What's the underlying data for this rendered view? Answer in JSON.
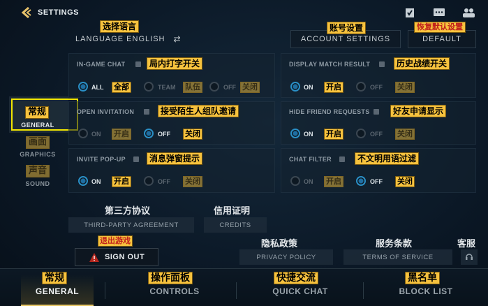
{
  "header": {
    "title": "SETTINGS"
  },
  "language": {
    "label": "LANGUAGE ENGLISH",
    "tag": "选择语言"
  },
  "account": {
    "label": "ACCOUNT SETTINGS",
    "tag": "账号设置"
  },
  "default": {
    "label": "DEFAULT",
    "tag": "恢复默认设置"
  },
  "left_nav": [
    {
      "label": "GENERAL",
      "tag": "常规"
    },
    {
      "label": "GRAPHICS",
      "tag": "画面"
    },
    {
      "label": "SOUND",
      "tag": "声音"
    }
  ],
  "settings": {
    "in_game_chat": {
      "label": "IN-GAME CHAT",
      "tag": "局内打字开关",
      "options": [
        {
          "label": "ALL",
          "tag": "全部",
          "selected": true
        },
        {
          "label": "TEAM",
          "tag": "队伍",
          "selected": false
        },
        {
          "label": "OFF",
          "tag": "关闭",
          "selected": false
        }
      ]
    },
    "display_match": {
      "label": "DISPLAY MATCH RESULT",
      "tag": "历史战绩开关",
      "on": "ON",
      "on_tag": "开启",
      "off": "OFF",
      "off_tag": "关闭",
      "value": "on"
    },
    "open_invitation": {
      "label": "OPEN INVITATION",
      "tag": "接受陌生人组队邀请",
      "on": "ON",
      "on_tag": "开启",
      "off": "OFF",
      "off_tag": "关闭",
      "value": "off"
    },
    "hide_friend": {
      "label": "HIDE FRIEND REQUESTS",
      "tag": "好友申请显示",
      "on": "ON",
      "on_tag": "开启",
      "off": "OFF",
      "off_tag": "关闭",
      "value": "on"
    },
    "invite_popup": {
      "label": "INVITE POP-UP",
      "tag": "消息弹窗提示",
      "on": "ON",
      "on_tag": "开启",
      "off": "OFF",
      "off_tag": "关闭",
      "value": "on"
    },
    "chat_filter": {
      "label": "CHAT FILTER",
      "tag": "不文明用语过滤",
      "on": "ON",
      "on_tag": "开启",
      "off": "OFF",
      "off_tag": "关闭",
      "value": "off"
    }
  },
  "links": {
    "third_party": {
      "cn": "第三方协议",
      "label": "THIRD-PARTY AGREEMENT"
    },
    "credits": {
      "cn": "信用证明",
      "label": "CREDITS"
    },
    "privacy": {
      "cn": "隐私政策",
      "label": "PRIVACY POLICY"
    },
    "terms": {
      "cn": "服务条款",
      "label": "TERMS OF SERVICE"
    },
    "support": {
      "cn": "客服"
    }
  },
  "sign_out": {
    "label": "SIGN OUT",
    "tag": "退出游戏"
  },
  "bottom_tabs": [
    {
      "label": "GENERAL",
      "tag": "常规",
      "active": true
    },
    {
      "label": "CONTROLS",
      "tag": "操作面板"
    },
    {
      "label": "QUICK CHAT",
      "tag": "快捷交流"
    },
    {
      "label": "BLOCK LIST",
      "tag": "黑名单"
    }
  ],
  "colors": {
    "accent": "#f6c23e",
    "highlight_box": "#f2e600",
    "radio_on": "#2a8fc6",
    "sign_out": "#b3261e"
  }
}
